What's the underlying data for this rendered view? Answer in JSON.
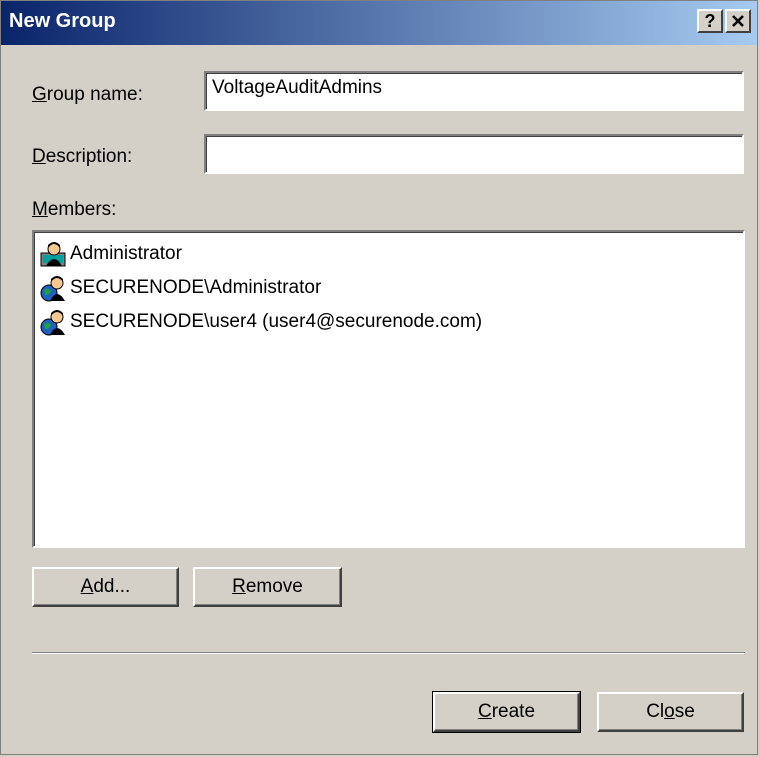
{
  "dialog": {
    "title": "New Group",
    "help_button": "?",
    "close_x": "✕"
  },
  "form": {
    "group_name_label_u": "G",
    "group_name_label_rest": "roup name:",
    "group_name_value": "VoltageAuditAdmins",
    "description_label_u": "D",
    "description_label_rest": "escription:",
    "description_value": "",
    "members_label_u": "M",
    "members_label_rest": "embers:"
  },
  "members": [
    {
      "name": "Administrator",
      "icon": "local-user-icon"
    },
    {
      "name": "SECURENODE\\Administrator",
      "icon": "domain-user-icon"
    },
    {
      "name": "SECURENODE\\user4 (user4@securenode.com)",
      "icon": "domain-user-icon"
    }
  ],
  "buttons": {
    "add_u": "A",
    "add_rest": "dd...",
    "remove_u": "R",
    "remove_rest": "emove",
    "create_u": "C",
    "create_rest": "reate",
    "close_pre": "Cl",
    "close_u": "o",
    "close_rest": "se"
  }
}
